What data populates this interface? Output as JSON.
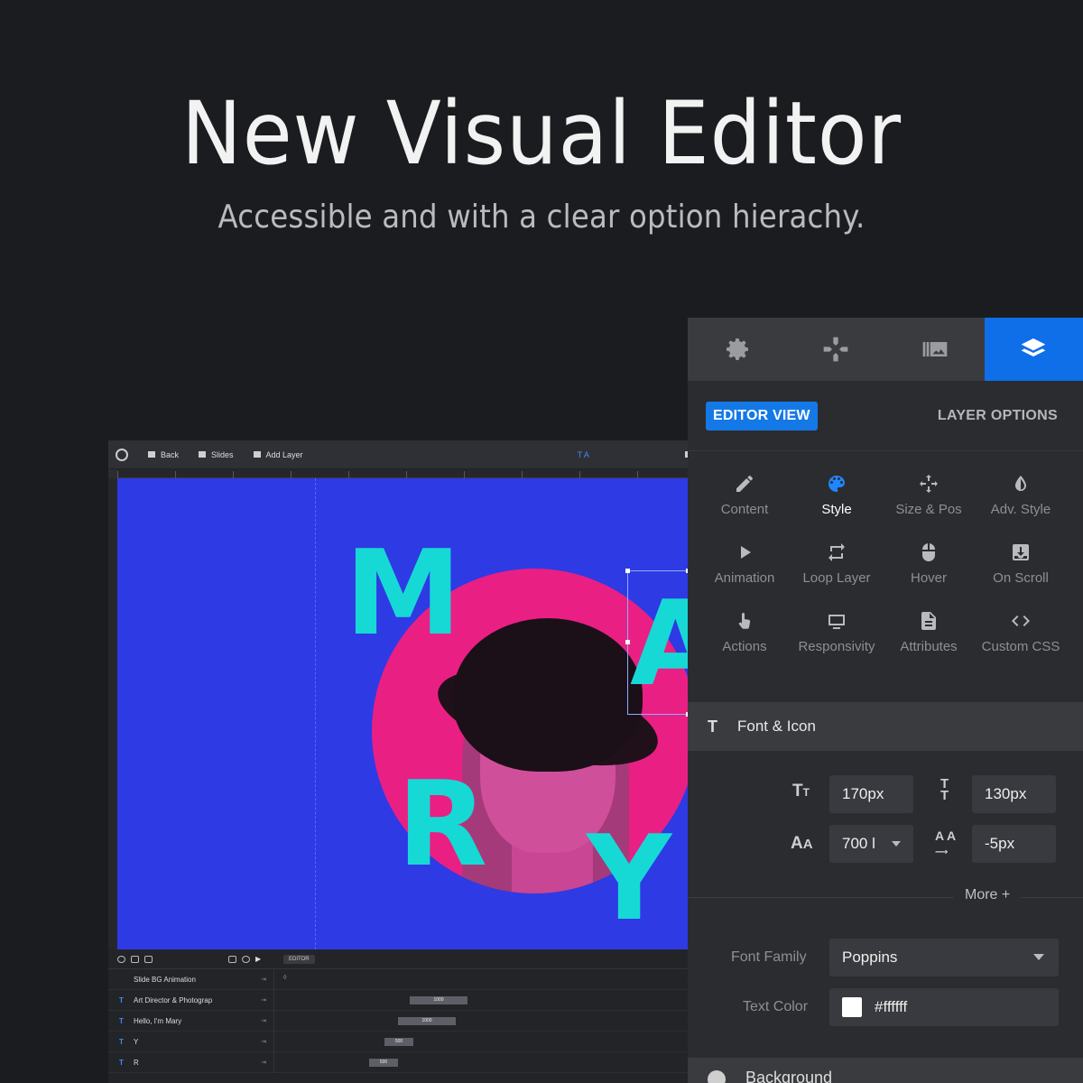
{
  "hero": {
    "title": "New Visual Editor",
    "subtitle": "Accessible and with a clear option hierachy."
  },
  "mini_editor": {
    "toolbar": {
      "back": "Back",
      "slides": "Slides",
      "add_layer": "Add Layer",
      "text_mark": "T  A"
    },
    "canvas_letters": [
      "M",
      "A",
      "R",
      "Y"
    ],
    "timeline": {
      "tag": "EDITOR",
      "rows": [
        {
          "type": "",
          "name": "Slide BG Animation",
          "bar": ""
        },
        {
          "type": "T",
          "name": "Art Director & Photograp",
          "bar": "1000"
        },
        {
          "type": "T",
          "name": "Hello, I'm Mary",
          "bar": "1000"
        },
        {
          "type": "T",
          "name": "Y",
          "bar": "500"
        },
        {
          "type": "T",
          "name": "R",
          "bar": "500"
        }
      ]
    }
  },
  "panel": {
    "tabs": [
      "gear-icon",
      "gamepad-icon",
      "slides-icon",
      "layers-icon"
    ],
    "active_tab": 3,
    "editor_view": "EDITOR VIEW",
    "layer_options": "LAYER OPTIONS",
    "options": [
      {
        "label": "Content",
        "icon": "pencil-icon"
      },
      {
        "label": "Style",
        "icon": "palette-icon",
        "active": true
      },
      {
        "label": "Size & Pos",
        "icon": "move-icon"
      },
      {
        "label": "Adv. Style",
        "icon": "contrast-icon"
      },
      {
        "label": "Animation",
        "icon": "play-icon"
      },
      {
        "label": "Loop Layer",
        "icon": "loop-icon"
      },
      {
        "label": "Hover",
        "icon": "mouse-icon"
      },
      {
        "label": "On Scroll",
        "icon": "scroll-icon"
      },
      {
        "label": "Actions",
        "icon": "hand-icon"
      },
      {
        "label": "Responsivity",
        "icon": "responsive-icon"
      },
      {
        "label": "Attributes",
        "icon": "document-icon"
      },
      {
        "label": "Custom CSS",
        "icon": "code-icon"
      }
    ],
    "font_section": {
      "title": "Font & Icon",
      "font_size": "170px",
      "line_height": "130px",
      "font_weight": "700 l",
      "letter_spacing": "-5px",
      "more": "More +",
      "font_family_label": "Font Family",
      "font_family": "Poppins",
      "text_color_label": "Text Color",
      "text_color": "#ffffff"
    },
    "background_title": "Background"
  },
  "colors": {
    "accent": "#0e6fe8",
    "canvas": "#2e3ae4",
    "circle": "#ea1f84",
    "letters": "#16d9d6"
  }
}
